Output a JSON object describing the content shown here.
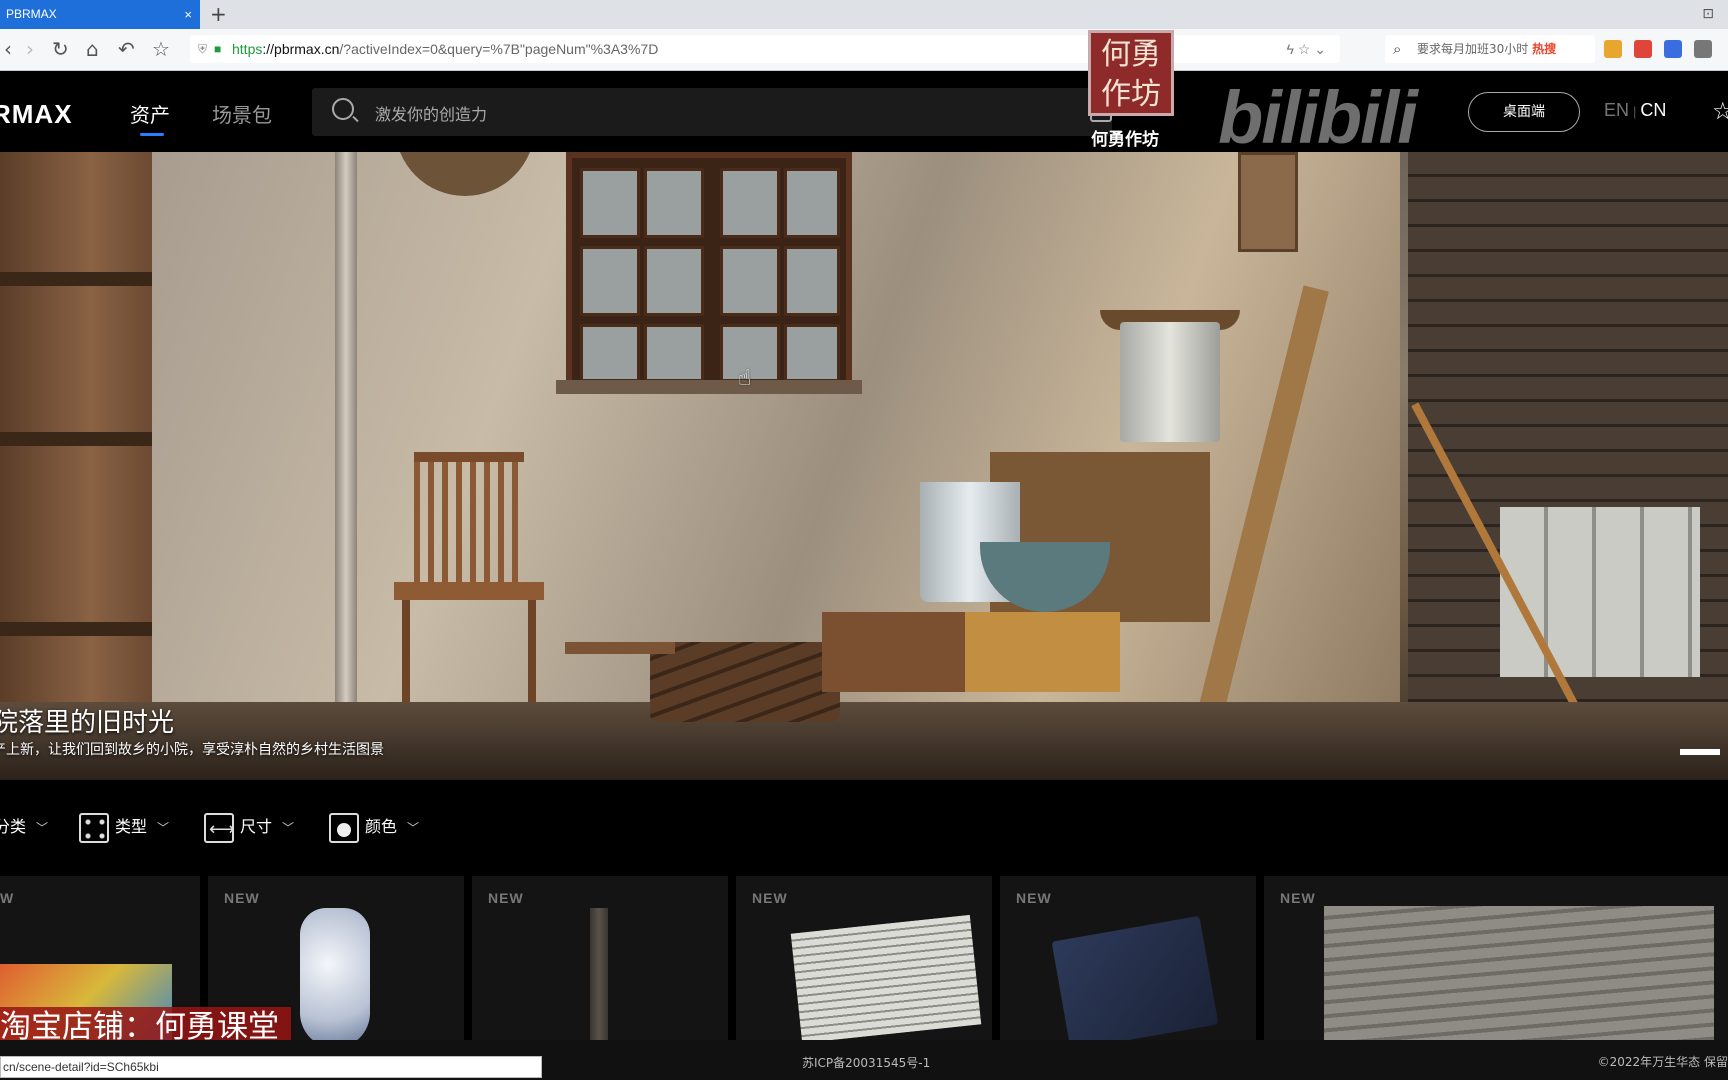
{
  "browser": {
    "tab_title": "PBRMAX",
    "tab_close": "×",
    "new_tab": "+",
    "url_https": "https",
    "url_host": "://pbrmax.cn",
    "url_rest": "/?activeIndex=0&query=%7B\"pageNum\"%3A3%7D",
    "search_hint": "要求每月加班30小时",
    "search_hot": "热搜",
    "status_url": "cn/scene-detail?id=SCh65kbi"
  },
  "header": {
    "logo": "RMAX",
    "nav": [
      {
        "label": "资产",
        "active": true
      },
      {
        "label": "场景包",
        "active": false
      }
    ],
    "search_placeholder": "激发你的创造力",
    "desktop_button": "桌面端",
    "lang_en": "EN",
    "lang_sep": "|",
    "lang_cn": "CN"
  },
  "watermark": {
    "seal_text": "何勇作坊",
    "caption": "何勇作坊",
    "site": "bilibili"
  },
  "hero": {
    "title": "院落里的旧时光",
    "subtitle": "产上新，让我们回到故乡的小院，享受淳朴自然的乡村生活图景"
  },
  "filters": [
    {
      "label": "分类",
      "icon": "category-icon"
    },
    {
      "label": "类型",
      "icon": "grid-icon"
    },
    {
      "label": "尺寸",
      "icon": "ruler-icon"
    },
    {
      "label": "颜色",
      "icon": "color-icon"
    }
  ],
  "cards": [
    {
      "tag": "W",
      "subject": "toy-box"
    },
    {
      "tag": "NEW",
      "subject": "porcelain-vase"
    },
    {
      "tag": "NEW",
      "subject": "wooden-stick"
    },
    {
      "tag": "NEW",
      "subject": "newspaper"
    },
    {
      "tag": "NEW",
      "subject": "book"
    },
    {
      "tag": "NEW",
      "subject": "rock-surface"
    }
  ],
  "overlay": {
    "shop_text": "淘宝店铺：何勇课堂"
  },
  "footer": {
    "icp": "苏ICP备20031545号-1",
    "copyright": "©2022年万生华态 保留"
  },
  "colors": {
    "accent": "#2a7fff",
    "tab_blue": "#1e6fd9",
    "background": "#000000"
  }
}
